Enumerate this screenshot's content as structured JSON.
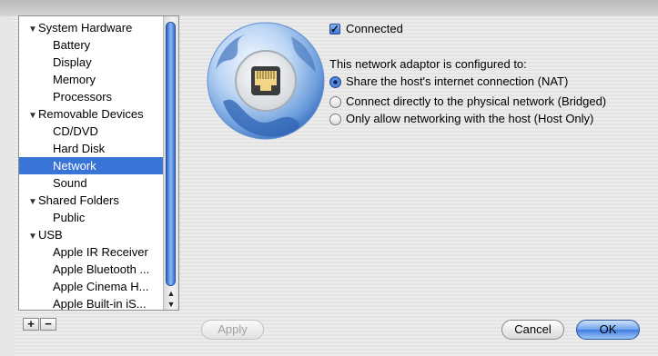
{
  "sidebar": {
    "groups": [
      {
        "label": "System Hardware",
        "items": [
          "Battery",
          "Display",
          "Memory",
          "Processors"
        ]
      },
      {
        "label": "Removable Devices",
        "items": [
          "CD/DVD",
          "Hard Disk",
          "Network",
          "Sound"
        ]
      },
      {
        "label": "Shared Folders",
        "items": [
          "Public"
        ]
      },
      {
        "label": "USB",
        "items": [
          "Apple IR Receiver",
          "Apple Bluetooth ...",
          "Apple Cinema H...",
          "Apple Built-in iS..."
        ]
      }
    ],
    "selected": "Network",
    "add_button": "+",
    "remove_button": "−"
  },
  "network": {
    "connected_label": "Connected",
    "connected_checked": true,
    "description": "This network adaptor is configured to:",
    "options": [
      "Share the host's internet connection (NAT)",
      "Connect directly to the physical network (Bridged)",
      "Only allow networking with the host (Host Only)"
    ],
    "selected_option": "Share the host's internet connection (NAT)"
  },
  "buttons": {
    "apply": "Apply",
    "cancel": "Cancel",
    "ok": "OK"
  },
  "icons": {
    "network": "ethernet-globe-icon",
    "tree_expanded": "triangle-down-icon"
  },
  "colors": {
    "selection": "#3875d7",
    "accent": "#3f7de0"
  }
}
